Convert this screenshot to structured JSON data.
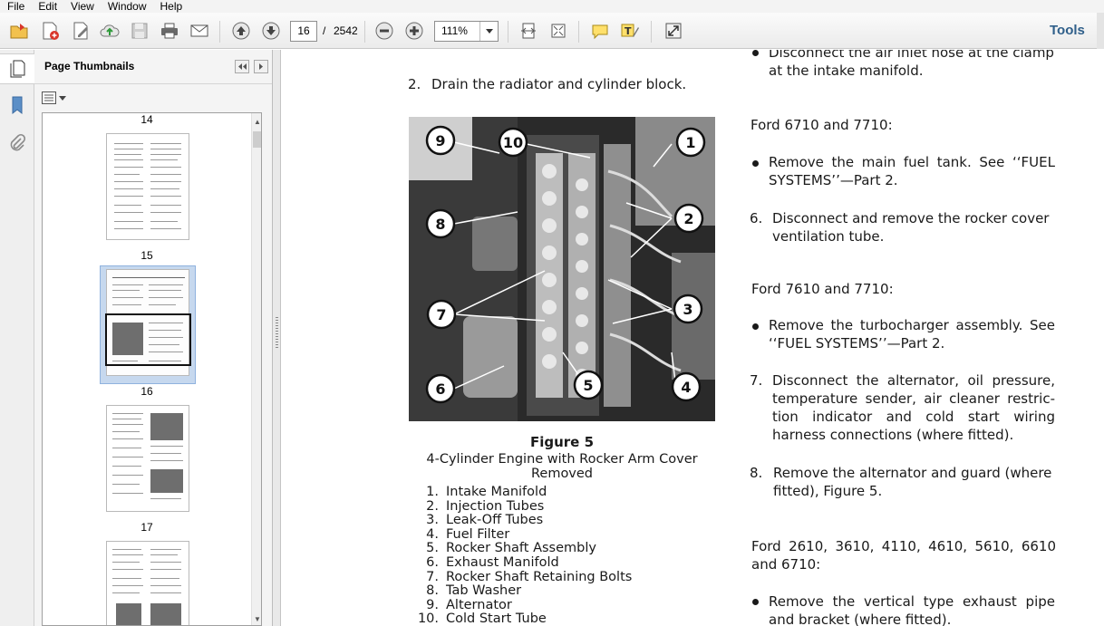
{
  "menu": [
    "File",
    "Edit",
    "View",
    "Window",
    "Help"
  ],
  "toolbar": {
    "current_page": "16",
    "page_separator": "/",
    "total_pages": "2542",
    "zoom": "111%",
    "tools_label": "Tools"
  },
  "sidebar": {
    "title": "Page Thumbnails",
    "thumbnails": [
      {
        "label": "14"
      },
      {
        "label": "15"
      },
      {
        "label": "16"
      },
      {
        "label": "17"
      }
    ]
  },
  "document": {
    "left_column": {
      "step2": {
        "num": "2.",
        "text": "Drain the radiator and cylinder block."
      },
      "figure": {
        "callouts": [
          "9",
          "10",
          "1",
          "8",
          "2",
          "7",
          "3",
          "6",
          "5",
          "4"
        ],
        "title": "Figure 5",
        "caption": "4-Cylinder Engine with Rocker Arm Cover Removed",
        "legend": [
          {
            "num": "1.",
            "text": "Intake Manifold"
          },
          {
            "num": "2.",
            "text": "Injection Tubes"
          },
          {
            "num": "3.",
            "text": "Leak-Off Tubes"
          },
          {
            "num": "4.",
            "text": "Fuel Filter"
          },
          {
            "num": "5.",
            "text": "Rocker Shaft Assembly"
          },
          {
            "num": "6.",
            "text": "Exhaust Manifold"
          },
          {
            "num": "7.",
            "text": "Rocker Shaft Retaining Bolts"
          },
          {
            "num": "8.",
            "text": "Tab Washer"
          },
          {
            "num": "9.",
            "text": "Alternator"
          },
          {
            "num": "10.",
            "text": "Cold Start Tube"
          }
        ]
      }
    },
    "right_column": {
      "bullet1": {
        "line1": "Disconnect the air inlet hose at the clamp",
        "line2": "at the intake manifold."
      },
      "heading1": "Ford 6710 and 7710:",
      "bullet2": {
        "line1": "Remove the main fuel tank. See ‘‘FUEL",
        "line2": "SYSTEMS’’—Part 2."
      },
      "step6": {
        "num": "6.",
        "line1": "Disconnect and remove the rocker cover",
        "line2": "ventilation tube."
      },
      "heading2": "Ford 7610 and 7710:",
      "bullet3": {
        "line1": "Remove the turbocharger assembly. See",
        "line2": "‘‘FUEL SYSTEMS’’—Part 2."
      },
      "step7": {
        "num": "7.",
        "line1": "Disconnect the alternator, oil pressure,",
        "line2": "temperature sender, air cleaner restric-",
        "line3": "tion indicator and cold start wiring",
        "line4": "harness connections (where fitted)."
      },
      "step8": {
        "num": "8.",
        "line1": "Remove the alternator and guard (where",
        "line2": "fitted), Figure 5."
      },
      "heading3": {
        "line1": "Ford 2610, 3610, 4110, 4610, 5610, 6610",
        "line2": "and 6710:"
      },
      "bullet4": {
        "line1": "Remove the vertical type exhaust pipe",
        "line2": "and bracket (where fitted)."
      }
    }
  }
}
